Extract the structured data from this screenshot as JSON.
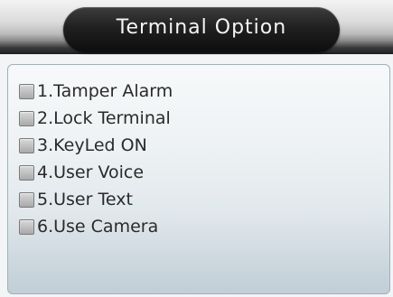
{
  "header": {
    "title": "Terminal Option"
  },
  "options": [
    {
      "label": "1.Tamper Alarm",
      "checked": false
    },
    {
      "label": "2.Lock Terminal",
      "checked": false
    },
    {
      "label": "3.KeyLed ON",
      "checked": false
    },
    {
      "label": "4.User Voice",
      "checked": false
    },
    {
      "label": "5.User Text",
      "checked": false
    },
    {
      "label": "6.Use Camera",
      "checked": false
    }
  ],
  "colors": {
    "title_pill": "#1a1a1a",
    "title_text": "#f4f4f4",
    "option_text": "#2a2a2a",
    "panel_border": "#9fb1bd"
  }
}
